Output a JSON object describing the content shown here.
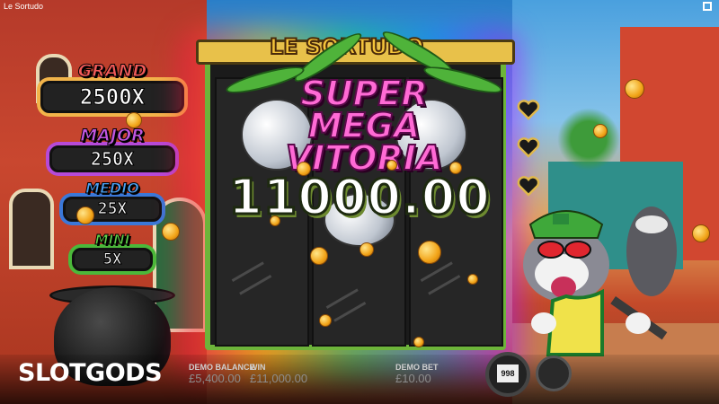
{
  "window": {
    "title": "Le Sortudo"
  },
  "jackpots": {
    "grand": {
      "label": "GRAND",
      "value": "2500X"
    },
    "major": {
      "label": "MAJOR",
      "value": "250X"
    },
    "medio": {
      "label": "MEDIO",
      "value": "25X"
    },
    "mini": {
      "label": "MINI",
      "value": "5X"
    }
  },
  "game": {
    "logo": "LE SORTUDO",
    "win_title_line1": "SUPER",
    "win_title_line2": "MEGA VITORIA",
    "win_amount": "11000.00"
  },
  "bottom_bar": {
    "brand": "SLOTGODS",
    "demo_balance_label": "DEMO BALANCE",
    "demo_balance_value": "£5,400.00",
    "win_label": "WIN",
    "win_value": "£11,000.00",
    "demo_bet_label": "DEMO BET",
    "demo_bet_value": "£10.00",
    "autoplay_count": "998"
  },
  "icons": {
    "fullscreen": "fullscreen-icon",
    "hearts": "heart-icon",
    "spin": "spin-button-icon"
  },
  "colors": {
    "grand": "#f25a5a",
    "major": "#c056e0",
    "medio": "#4aa0f2",
    "mini": "#5fd24a",
    "win_title": "#ff6ad5",
    "brand_bolt": "#f5c400"
  }
}
